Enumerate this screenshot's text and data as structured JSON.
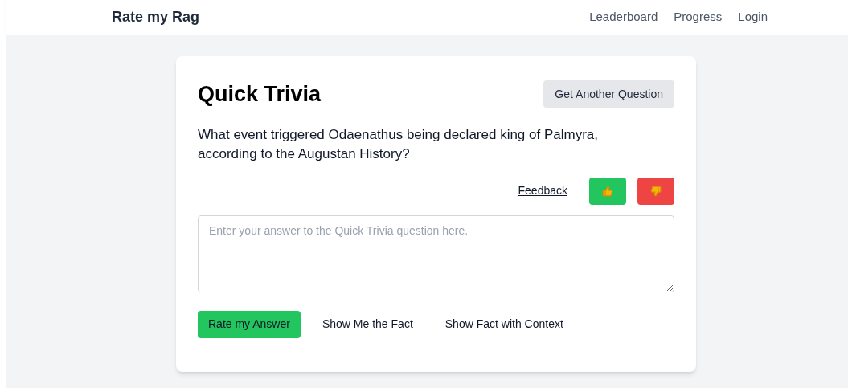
{
  "nav": {
    "brand": "Rate my Rag",
    "links": [
      "Leaderboard",
      "Progress",
      "Login"
    ]
  },
  "card": {
    "title": "Quick Trivia",
    "new_question_button": "Get Another Question",
    "question": "What event triggered Odaenathus being declared king of Palmyra, according to the Augustan History?",
    "feedback_link": "Feedback",
    "answer": {
      "placeholder": "Enter your answer to the Quick Trivia question here."
    },
    "actions": [
      {
        "kind": "button",
        "label": "Rate my Answer"
      },
      {
        "kind": "link",
        "label": "Show Me the Fact"
      },
      {
        "kind": "link",
        "label": "Show Fact with Context"
      }
    ]
  }
}
